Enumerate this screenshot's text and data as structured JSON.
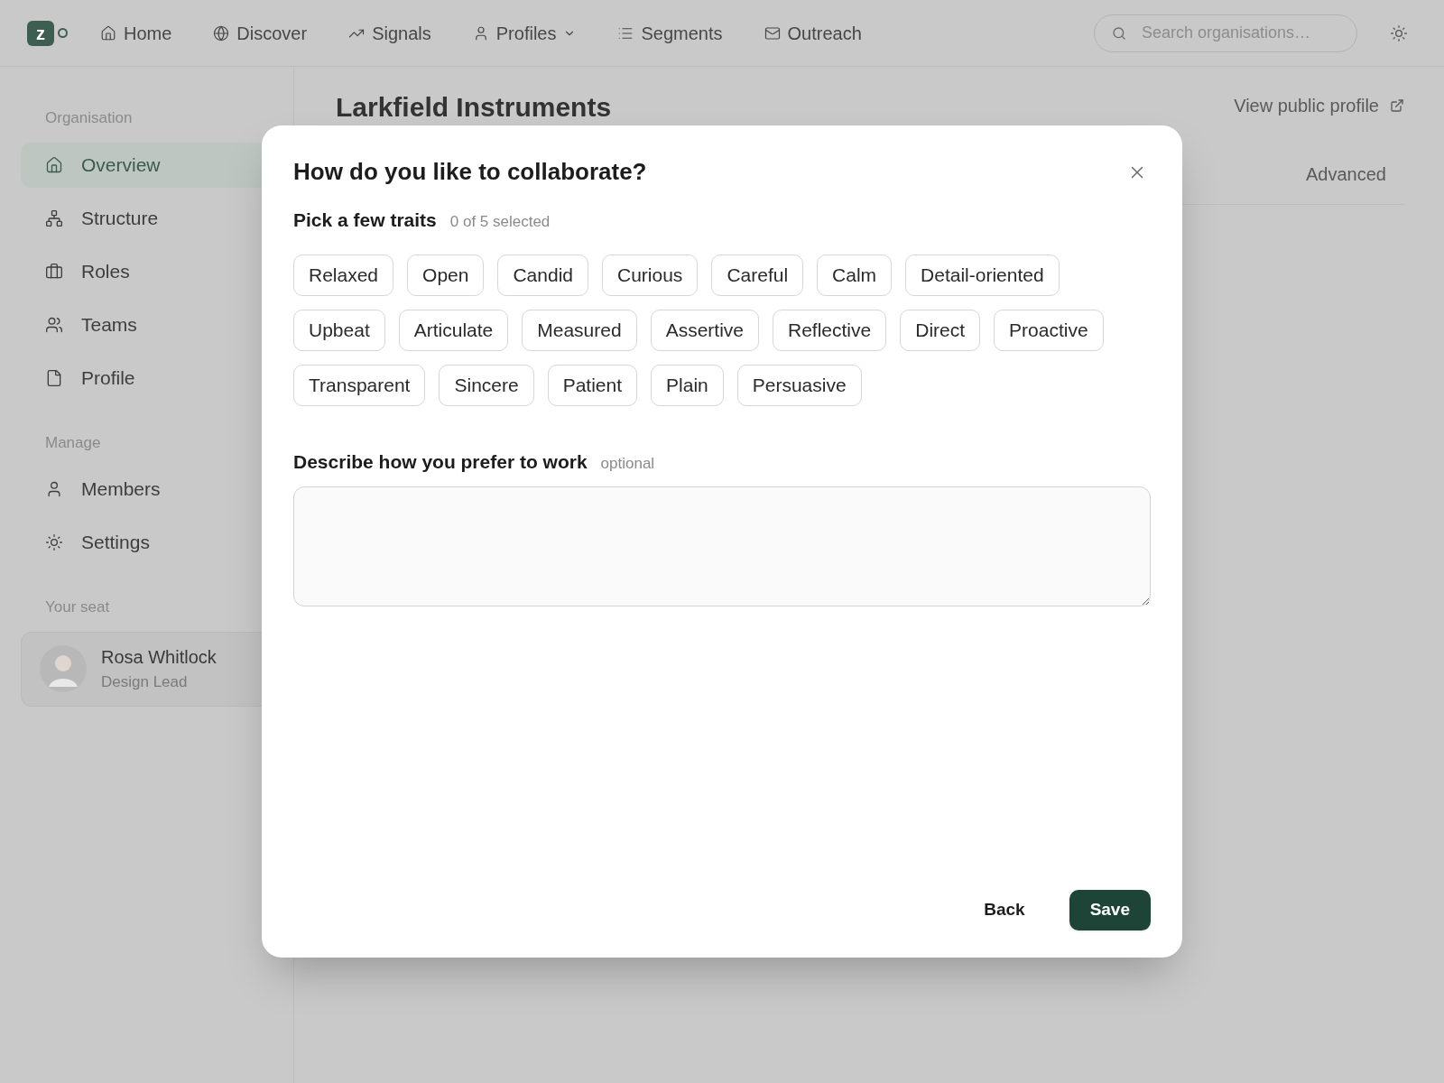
{
  "topbar": {
    "logo": "z",
    "nav": [
      {
        "label": "Home",
        "selected": false
      },
      {
        "label": "Discover",
        "selected": false
      },
      {
        "label": "Signals",
        "selected": false
      },
      {
        "label": "Profiles",
        "selected": false,
        "dropdown": true
      },
      {
        "label": "Segments",
        "selected": false
      },
      {
        "label": "Outreach",
        "selected": false
      }
    ],
    "search": {
      "placeholder": "Search organisations…"
    }
  },
  "sidebar": {
    "sections": [
      {
        "heading": "Organisation",
        "items": [
          {
            "label": "Overview",
            "selected": true
          },
          {
            "label": "Structure",
            "selected": false
          },
          {
            "label": "Roles",
            "selected": false
          },
          {
            "label": "Teams",
            "selected": false
          },
          {
            "label": "Profile",
            "selected": false
          }
        ]
      },
      {
        "heading": "Manage",
        "items": [
          {
            "label": "Members",
            "selected": false
          },
          {
            "label": "Settings",
            "selected": false
          }
        ]
      }
    ],
    "seat": {
      "heading": "Your seat",
      "name": "Rosa Whitlock",
      "role": "Design Lead"
    }
  },
  "main": {
    "title": "Larkfield Instruments",
    "public_link": "View public profile",
    "tabs": [
      {
        "label": "Advanced",
        "selected": false
      }
    ]
  },
  "dialog": {
    "title": "How do you like to collaborate?",
    "traits_label": "Pick a few traits",
    "traits_count": "0 of 5 selected",
    "traits": [
      {
        "label": "Relaxed",
        "selected": false
      },
      {
        "label": "Open",
        "selected": false
      },
      {
        "label": "Candid",
        "selected": false
      },
      {
        "label": "Curious",
        "selected": false
      },
      {
        "label": "Careful",
        "selected": false
      },
      {
        "label": "Calm",
        "selected": false
      },
      {
        "label": "Detail-oriented",
        "selected": false
      },
      {
        "label": "Upbeat",
        "selected": false
      },
      {
        "label": "Articulate",
        "selected": false
      },
      {
        "label": "Measured",
        "selected": false
      },
      {
        "label": "Assertive",
        "selected": false
      },
      {
        "label": "Reflective",
        "selected": false
      },
      {
        "label": "Direct",
        "selected": false
      },
      {
        "label": "Proactive",
        "selected": false
      },
      {
        "label": "Transparent",
        "selected": false
      },
      {
        "label": "Sincere",
        "selected": false
      },
      {
        "label": "Patient",
        "selected": false
      },
      {
        "label": "Plain",
        "selected": false
      },
      {
        "label": "Persuasive",
        "selected": false
      }
    ],
    "describe_label": "Describe how you prefer to work",
    "describe_hint": "optional",
    "buttons": [
      {
        "label": "Back",
        "kind": "secondary"
      },
      {
        "label": "Save",
        "kind": "primary"
      }
    ]
  }
}
